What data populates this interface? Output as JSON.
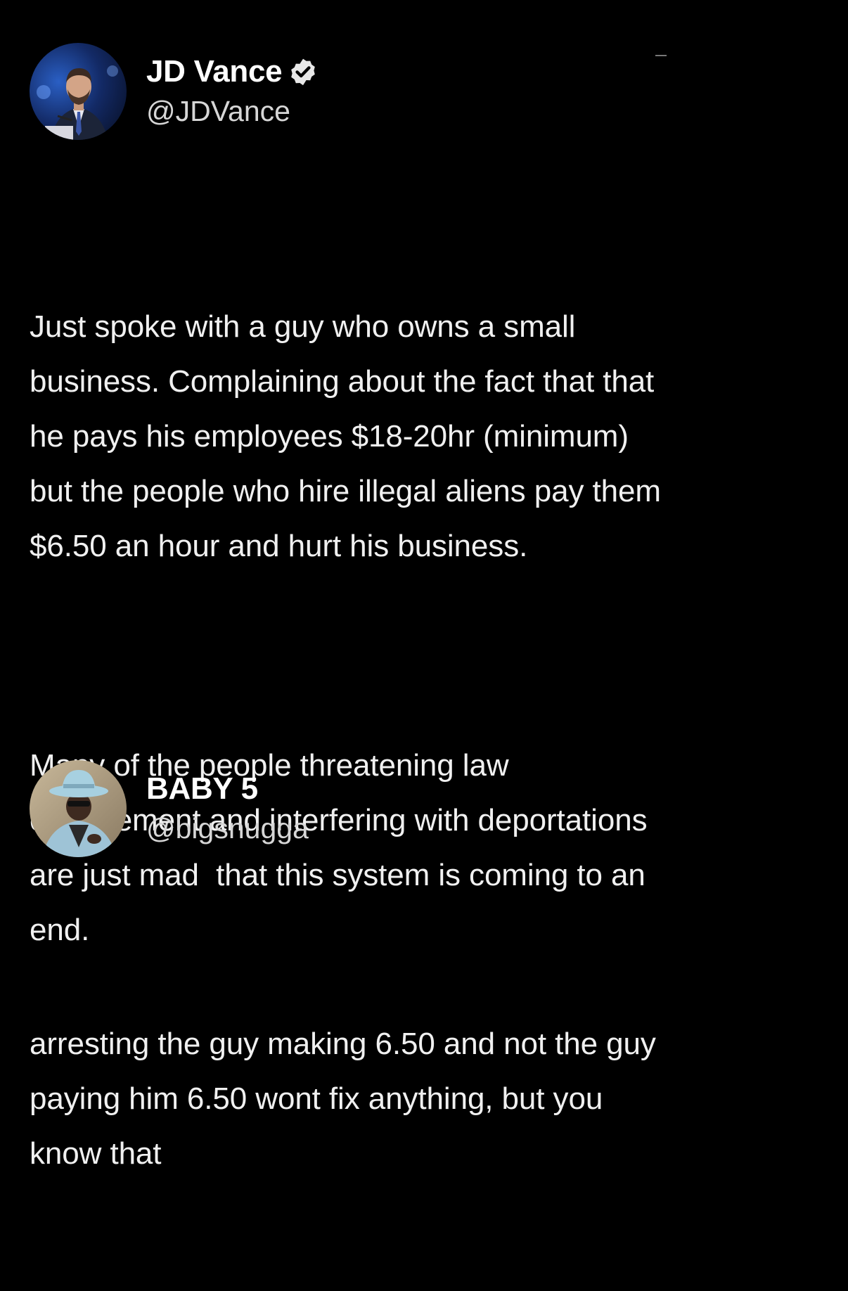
{
  "colors": {
    "background": "#000000",
    "text": "#f0f0f0",
    "handle": "#d6d6d6",
    "verified_badge": "#e8e8e8"
  },
  "posts": [
    {
      "display_name": "JD Vance",
      "verified": true,
      "verified_icon": "verified-badge-icon",
      "handle": "@JDVance",
      "avatar_icon": "profile-photo",
      "paragraphs": [
        "Just spoke with a guy who owns a small\nbusiness. Complaining about the fact that that\nhe pays his employees $18-20hr (minimum)\nbut the people who hire illegal aliens pay them\n$6.50 an hour and hurt his business.",
        "Many of the people threatening law\nenforcement and interfering with deportations\nare just mad  that this system is coming to an\nend."
      ]
    },
    {
      "display_name": "BABY 5",
      "verified": false,
      "handle": "@bigsnugga",
      "avatar_icon": "profile-photo",
      "paragraphs": [
        "arresting the guy making 6.50 and not the guy\npaying him 6.50 wont fix anything, but you\nknow that"
      ]
    }
  ]
}
